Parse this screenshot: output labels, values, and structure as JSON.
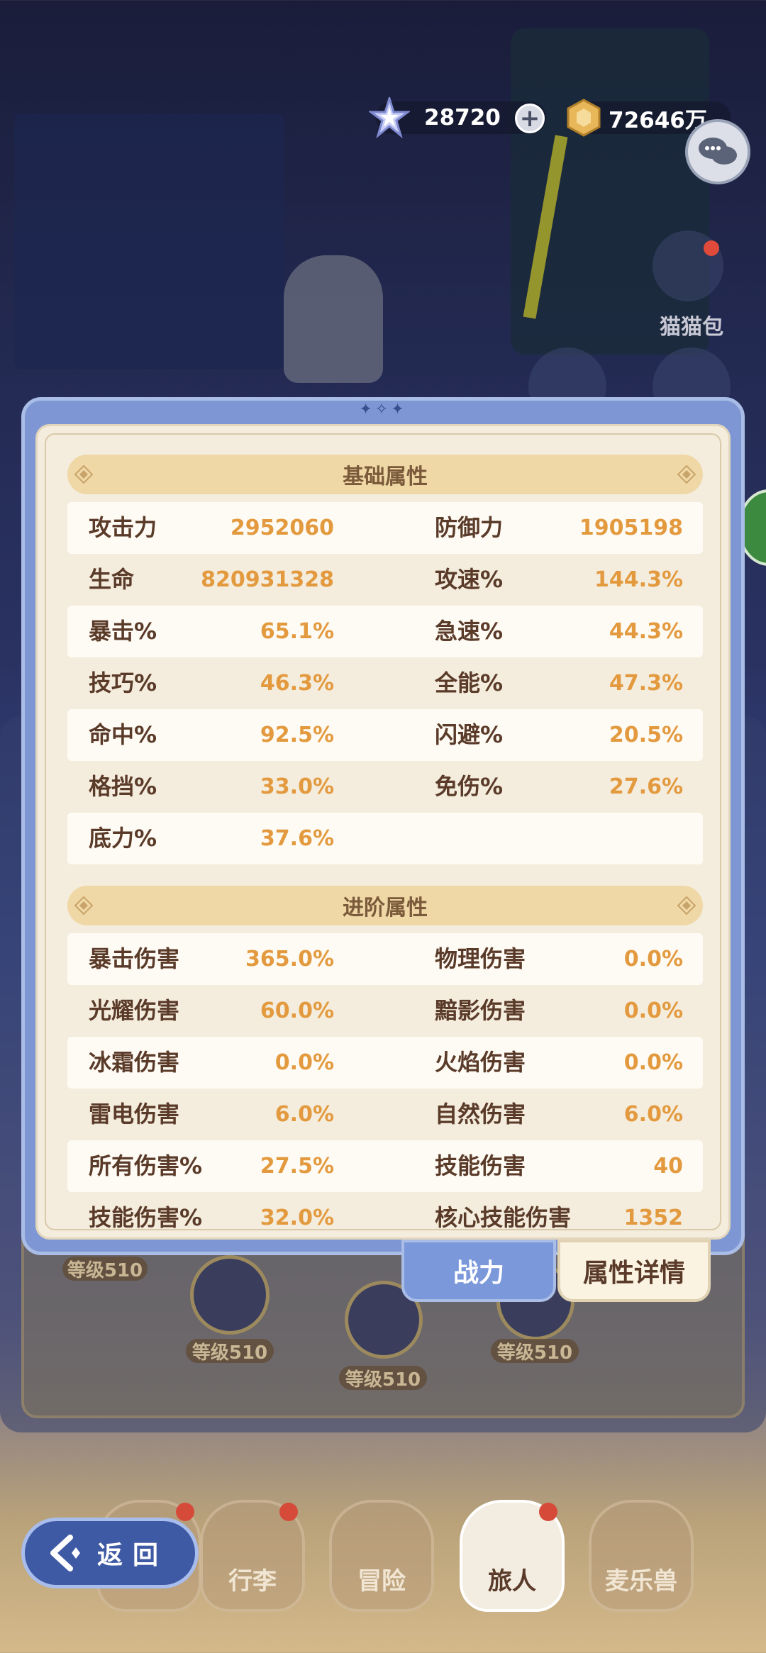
{
  "currency": {
    "gems": "28720",
    "gold": "72646万",
    "plus": "+"
  },
  "side": {
    "cat_bag": "猫猫包"
  },
  "team": {
    "levels": [
      "等级510",
      "等级510",
      "等级510",
      "等级510"
    ]
  },
  "basic": {
    "title": "基础属性",
    "rows": [
      {
        "l1": "攻击力",
        "v1": "2952060",
        "l2": "防御力",
        "v2": "1905198"
      },
      {
        "l1": "生命",
        "v1": "820931328",
        "l2": "攻速%",
        "v2": "144.3%"
      },
      {
        "l1": "暴击%",
        "v1": "65.1%",
        "l2": "急速%",
        "v2": "44.3%"
      },
      {
        "l1": "技巧%",
        "v1": "46.3%",
        "l2": "全能%",
        "v2": "47.3%"
      },
      {
        "l1": "命中%",
        "v1": "92.5%",
        "l2": "闪避%",
        "v2": "20.5%"
      },
      {
        "l1": "格挡%",
        "v1": "33.0%",
        "l2": "免伤%",
        "v2": "27.6%"
      },
      {
        "l1": "底力%",
        "v1": "37.6%",
        "l2": "",
        "v2": ""
      }
    ]
  },
  "advanced": {
    "title": "进阶属性",
    "rows": [
      {
        "l1": "暴击伤害",
        "v1": "365.0%",
        "l2": "物理伤害",
        "v2": "0.0%"
      },
      {
        "l1": "光耀伤害",
        "v1": "60.0%",
        "l2": "黯影伤害",
        "v2": "0.0%"
      },
      {
        "l1": "冰霜伤害",
        "v1": "0.0%",
        "l2": "火焰伤害",
        "v2": "0.0%"
      },
      {
        "l1": "雷电伤害",
        "v1": "6.0%",
        "l2": "自然伤害",
        "v2": "6.0%"
      },
      {
        "l1": "所有伤害%",
        "v1": "27.5%",
        "l2": "技能伤害",
        "v2": "40"
      },
      {
        "l1": "技能伤害%",
        "v1": "32.0%",
        "l2": "核心技能伤害",
        "v2": "1352"
      }
    ]
  },
  "tabs": {
    "power": "战力",
    "detail": "属性详情"
  },
  "nav": {
    "back": "返回",
    "items": [
      "行李",
      "冒险",
      "旅人",
      "麦乐兽"
    ]
  },
  "colors": {
    "label": "#5a3a28",
    "value": "#e39a3f",
    "modal": "#7e97d4",
    "section": "#efd8a6"
  }
}
